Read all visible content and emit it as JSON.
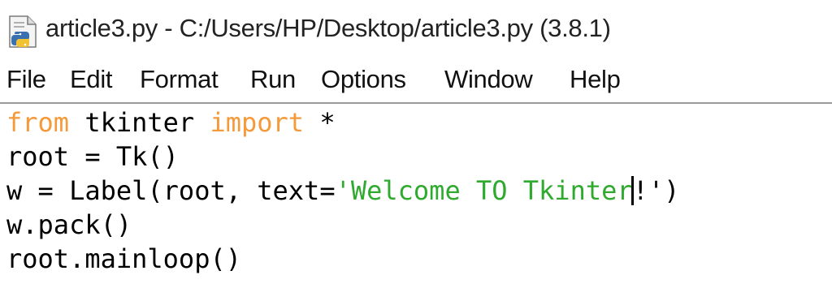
{
  "window": {
    "title": "article3.py - C:/Users/HP/Desktop/article3.py (3.8.1)",
    "icon": "python-file-icon"
  },
  "menu": {
    "items": [
      "File",
      "Edit",
      "Format",
      "Run",
      "Options",
      "Window",
      "Help"
    ]
  },
  "editor": {
    "lines": [
      [
        "from",
        " tkinter ",
        "import",
        " *"
      ],
      [
        "root = Tk()"
      ],
      [
        "w = Label(root, text=",
        "'Welcome TO Tkinter",
        "!')"
      ],
      [
        "w.pack()"
      ],
      [
        "root.mainloop()"
      ]
    ]
  },
  "colors": {
    "keyword": "#f59a3a",
    "string": "#2faa2f",
    "text": "#000000"
  }
}
